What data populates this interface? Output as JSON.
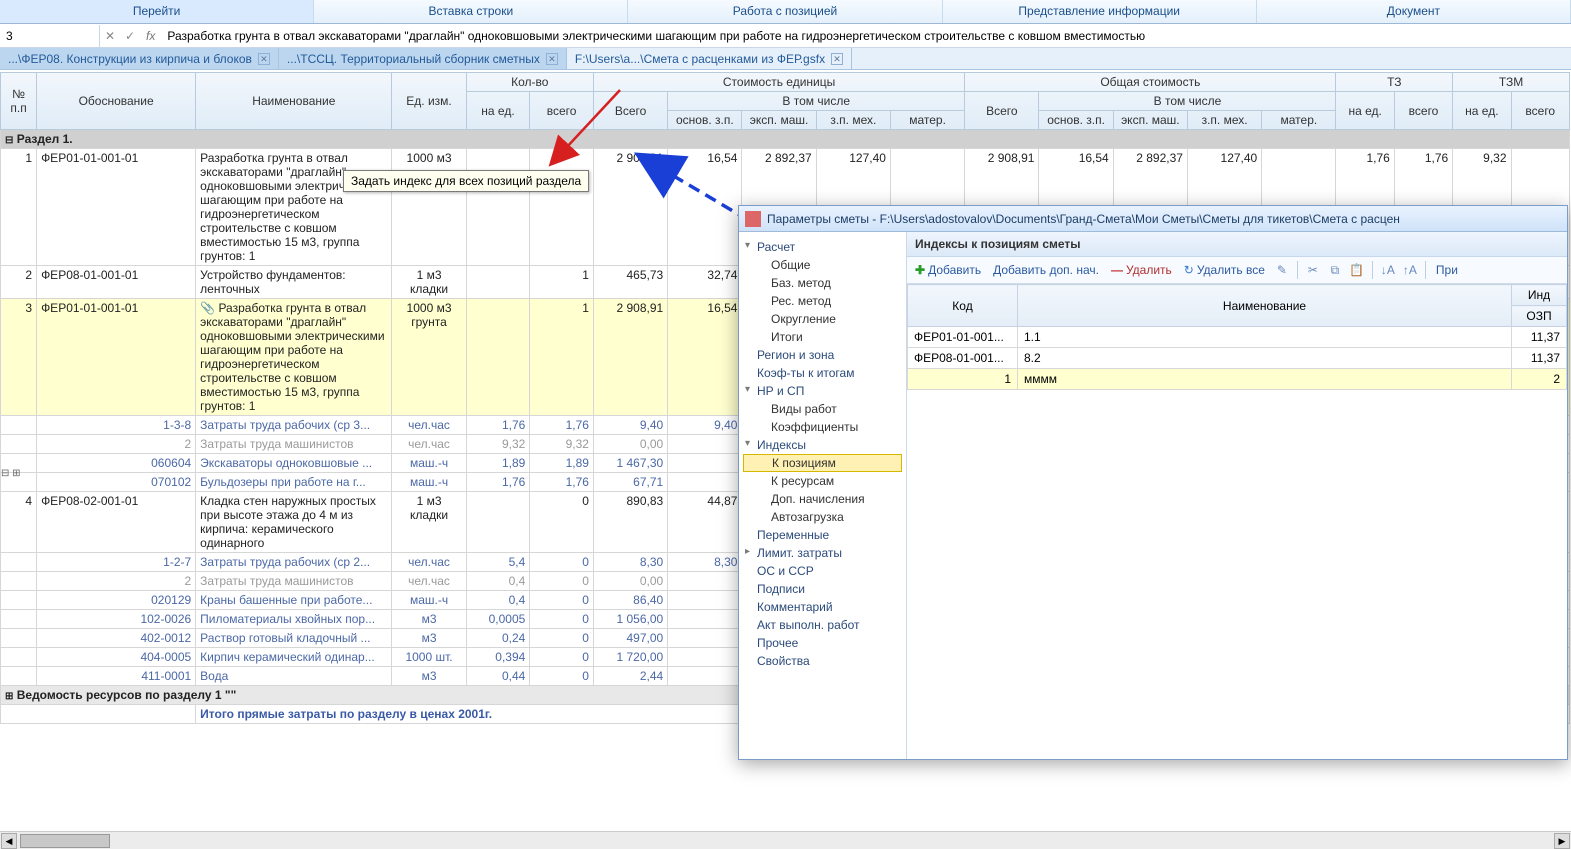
{
  "ribbon": [
    "Перейти",
    "Вставка строки",
    "Работа с позицией",
    "Представление информации",
    "Документ"
  ],
  "formula": {
    "cell": "3",
    "cancel": "✕",
    "accept": "✓",
    "fx": "fx",
    "text": "Разработка грунта в отвал экскаваторами \"драглайн\" одноковшовыми электрическими шагающим при работе на гидроэнергетическом строительстве с ковшом вместимостью"
  },
  "tabs": [
    {
      "label": "...\\ФЕР08. Конструкции из кирпича и блоков",
      "active": true,
      "close": true
    },
    {
      "label": "...\\ТССЦ. Территориальный сборник сметных",
      "active": true,
      "close": true
    },
    {
      "label": "F:\\Users\\a...\\Смета с расценками из ФЕР.gsfx",
      "active": false,
      "close": true
    }
  ],
  "headers": {
    "r1": [
      "№\nп.п",
      "Обоснование",
      "Наименование",
      "Ед. изм.",
      "Кол-во",
      "Стоимость единицы",
      "Общая стоимость",
      "ТЗ",
      "ТЗМ"
    ],
    "r2_kolvo": [
      "на ед.",
      "всего"
    ],
    "r2_unit": [
      "Всего",
      "В том числе"
    ],
    "r2_total": [
      "Всего",
      "В том числе"
    ],
    "r2_tz": [
      "на ед.",
      "всего"
    ],
    "r2_tzm": [
      "на ед.",
      "всего"
    ],
    "r3_unit": [
      "основ. з.п.",
      "эксп. маш.",
      "з.п. мех.",
      "матер."
    ],
    "r3_total": [
      "основ. з.п.",
      "эксп. маш.",
      "з.п. мех.",
      "матер."
    ]
  },
  "section": "Раздел 1.",
  "rows": [
    {
      "n": "1",
      "code": "ФЕР01-01-001-01",
      "name": "Разработка грунта в отвал экскаваторами \"драглайн\" одноковшовыми электрическими шагающим при работе на гидроэнергетическом строительстве с ковшом вместимостью 15 м3, группа грунтов: 1",
      "unit": "1000 м3",
      "qe": "",
      "qt": "",
      "total": "2 908,91",
      "c1": "16,54",
      "c2": "2 892,37",
      "c3": "127,40",
      "c4": "",
      "g": "2 908,91",
      "g1": "16,54",
      "g2": "2 892,37",
      "g3": "127,40",
      "g4": "",
      "tz1": "1,76",
      "tz2": "1,76",
      "tzm1": "9,32",
      "tzm2": ""
    },
    {
      "n": "2",
      "code": "ФЕР08-01-001-01",
      "name": "Устройство фундаментов: ленточных",
      "unit": "1 м3 кладки",
      "qe": "",
      "qt": "1",
      "total": "465,73",
      "c1": "32,74",
      "c2": "",
      "c3": "",
      "c4": "",
      "g": "",
      "g1": "",
      "g2": "",
      "g3": "",
      "g4": "",
      "tz1": "",
      "tz2": "",
      "tzm1": "",
      "tzm2": ""
    },
    {
      "n": "3",
      "code": "ФЕР01-01-001-01",
      "name": "Разработка грунта в отвал экскаваторами \"драглайн\" одноковшовыми электрическими шагающим при работе на гидроэнергетическом строительстве с ковшом вместимостью 15 м3, группа грунтов: 1",
      "unit": "1000 м3 грунта",
      "qe": "",
      "qt": "1",
      "total": "2 908,91",
      "c1": "16,54",
      "hl": true,
      "attach": true
    },
    {
      "sub": true,
      "code": "1-3-8",
      "name": "Затраты труда рабочих (ср 3...",
      "unit": "чел.час",
      "qe": "1,76",
      "qt": "1,76",
      "total": "9,40",
      "c1": "9,40"
    },
    {
      "sub": true,
      "gray": true,
      "code": "2",
      "name": "Затраты труда машинистов",
      "unit": "чел.час",
      "qe": "9,32",
      "qt": "9,32",
      "total": "0,00"
    },
    {
      "sub": true,
      "code": "060604",
      "name": "Экскаваторы одноковшовые ...",
      "unit": "маш.-ч",
      "qe": "1,89",
      "qt": "1,89",
      "total": "1 467,30"
    },
    {
      "sub": true,
      "code": "070102",
      "name": "Бульдозеры при работе на г...",
      "unit": "маш.-ч",
      "qe": "1,76",
      "qt": "1,76",
      "total": "67,71"
    },
    {
      "n": "4",
      "code": "ФЕР08-02-001-01",
      "name": "Кладка стен наружных простых при высоте этажа до 4 м из кирпича: керамического одинарного",
      "unit": "1 м3 кладки",
      "qe": "",
      "qt": "0",
      "total": "890,83",
      "c1": "44,87"
    },
    {
      "sub": true,
      "code": "1-2-7",
      "name": "Затраты труда рабочих (ср 2...",
      "unit": "чел.час",
      "qe": "5,4",
      "qt": "0",
      "total": "8,30",
      "c1": "8,30"
    },
    {
      "sub": true,
      "gray": true,
      "code": "2",
      "name": "Затраты труда машинистов",
      "unit": "чел.час",
      "qe": "0,4",
      "qt": "0",
      "total": "0,00"
    },
    {
      "sub": true,
      "code": "020129",
      "name": "Краны башенные при работе...",
      "unit": "маш.-ч",
      "qe": "0,4",
      "qt": "0",
      "total": "86,40"
    },
    {
      "sub": true,
      "code": "102-0026",
      "name": "Пиломатериалы хвойных пор...",
      "unit": "м3",
      "qe": "0,0005",
      "qt": "0",
      "total": "1 056,00"
    },
    {
      "sub": true,
      "code": "402-0012",
      "name": "Раствор готовый кладочный ...",
      "unit": "м3",
      "qe": "0,24",
      "qt": "0",
      "total": "497,00"
    },
    {
      "sub": true,
      "code": "404-0005",
      "name": "Кирпич керамический одинар...",
      "unit": "1000 шт.",
      "qe": "0,394",
      "qt": "0",
      "total": "1 720,00"
    },
    {
      "sub": true,
      "code": "411-0001",
      "name": "Вода",
      "unit": "м3",
      "qe": "0,44",
      "qt": "0",
      "total": "2,44"
    }
  ],
  "footer1": "Ведомость ресурсов по разделу 1 \"\"",
  "footer2": "Итого прямые затраты по разделу в ценах 2001г.",
  "tooltip": "Задать индекс для всех позиций раздела",
  "toggle": "⊟ ⊞",
  "dialog": {
    "title": "Параметры сметы - F:\\Users\\adostovalov\\Documents\\Гранд-Смета\\Мои Сметы\\Сметы для тикетов\\Смета с расцен",
    "tree": [
      {
        "t": "Расчет",
        "k": "section open"
      },
      {
        "t": "Общие",
        "k": "sub"
      },
      {
        "t": "Баз. метод",
        "k": "sub"
      },
      {
        "t": "Рес. метод",
        "k": "sub"
      },
      {
        "t": "Округление",
        "k": "sub"
      },
      {
        "t": "Итоги",
        "k": "sub"
      },
      {
        "t": "Регион и зона",
        "k": "item"
      },
      {
        "t": "Коэф-ты к итогам",
        "k": "item"
      },
      {
        "t": "НР и СП",
        "k": "section open"
      },
      {
        "t": "Виды работ",
        "k": "sub"
      },
      {
        "t": "Коэффициенты",
        "k": "sub"
      },
      {
        "t": "Индексы",
        "k": "section open"
      },
      {
        "t": "К позициям",
        "k": "sub selected"
      },
      {
        "t": "К ресурсам",
        "k": "sub"
      },
      {
        "t": "Доп. начисления",
        "k": "sub"
      },
      {
        "t": "Автозагрузка",
        "k": "sub"
      },
      {
        "t": "Переменные",
        "k": "item"
      },
      {
        "t": "Лимит. затраты",
        "k": "section"
      },
      {
        "t": "ОС и ССР",
        "k": "item"
      },
      {
        "t": "Подписи",
        "k": "item"
      },
      {
        "t": "Комментарий",
        "k": "item"
      },
      {
        "t": "Акт выполн. работ",
        "k": "item"
      },
      {
        "t": "Прочее",
        "k": "item"
      },
      {
        "t": "Свойства",
        "k": "item"
      }
    ],
    "pane_title": "Индексы к позициям сметы",
    "toolbar": {
      "add": "Добавить",
      "add2": "Добавить доп. нач.",
      "del": "Удалить",
      "delall": "Удалить все",
      "apply": "При"
    },
    "idx_head": [
      "Код",
      "Наименование",
      "Инд"
    ],
    "idx_sub": "ОЗП",
    "idx_rows": [
      {
        "code": "ФЕР01-01-001...",
        "name": "1.1",
        "v": "11,37"
      },
      {
        "code": "ФЕР08-01-001...",
        "name": "8.2",
        "v": "11,37"
      },
      {
        "code": "1",
        "name": "мммм",
        "v": "2",
        "editing": true
      }
    ]
  }
}
